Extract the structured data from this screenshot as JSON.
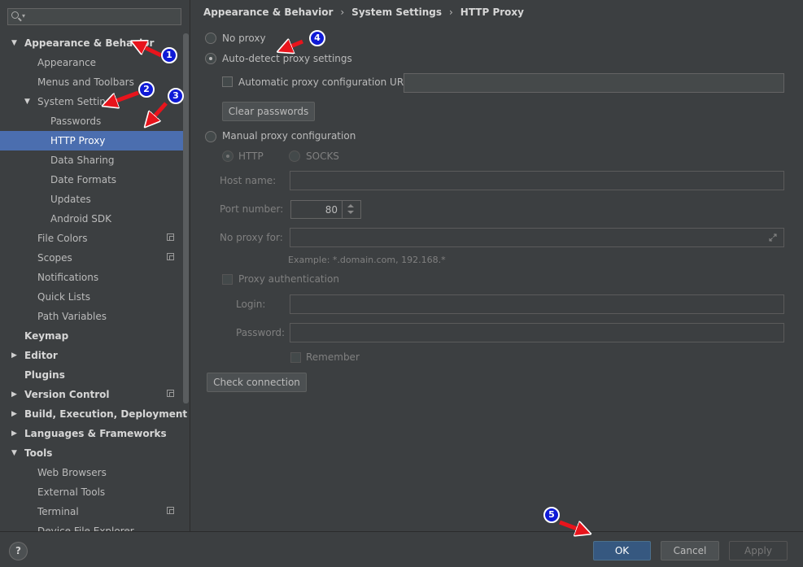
{
  "sidebar": {
    "items": [
      {
        "label": "Appearance & Behavior",
        "bold": true,
        "arrow": "down",
        "indent": 0
      },
      {
        "label": "Appearance",
        "indent": 1
      },
      {
        "label": "Menus and Toolbars",
        "indent": 1
      },
      {
        "label": "System Settings",
        "arrow": "down",
        "indent": 1
      },
      {
        "label": "Passwords",
        "indent": 2
      },
      {
        "label": "HTTP Proxy",
        "indent": 2,
        "selected": true
      },
      {
        "label": "Data Sharing",
        "indent": 2
      },
      {
        "label": "Date Formats",
        "indent": 2
      },
      {
        "label": "Updates",
        "indent": 2
      },
      {
        "label": "Android SDK",
        "indent": 2
      },
      {
        "label": "File Colors",
        "indent": 1,
        "project_icon": true
      },
      {
        "label": "Scopes",
        "indent": 1,
        "project_icon": true
      },
      {
        "label": "Notifications",
        "indent": 1
      },
      {
        "label": "Quick Lists",
        "indent": 1
      },
      {
        "label": "Path Variables",
        "indent": 1
      },
      {
        "label": "Keymap",
        "bold": true,
        "indent": 0
      },
      {
        "label": "Editor",
        "bold": true,
        "arrow": "right",
        "indent": 0
      },
      {
        "label": "Plugins",
        "bold": true,
        "indent": 0
      },
      {
        "label": "Version Control",
        "bold": true,
        "arrow": "right",
        "indent": 0,
        "project_icon": true
      },
      {
        "label": "Build, Execution, Deployment",
        "bold": true,
        "arrow": "right",
        "indent": 0
      },
      {
        "label": "Languages & Frameworks",
        "bold": true,
        "arrow": "right",
        "indent": 0
      },
      {
        "label": "Tools",
        "bold": true,
        "arrow": "down",
        "indent": 0
      },
      {
        "label": "Web Browsers",
        "indent": 1
      },
      {
        "label": "External Tools",
        "indent": 1
      },
      {
        "label": "Terminal",
        "indent": 1,
        "project_icon": true
      },
      {
        "label": "Device File Explorer",
        "indent": 1
      }
    ]
  },
  "breadcrumb": [
    "Appearance & Behavior",
    "System Settings",
    "HTTP Proxy"
  ],
  "proxy": {
    "no_proxy_label": "No proxy",
    "auto_detect_label": "Auto-detect proxy settings",
    "auto_config_url_label": "Automatic proxy configuration URL:",
    "auto_config_url_value": "",
    "clear_passwords_label": "Clear passwords",
    "manual_label": "Manual proxy configuration",
    "http_label": "HTTP",
    "socks_label": "SOCKS",
    "host_name_label": "Host name:",
    "host_name_value": "",
    "port_label": "Port number:",
    "port_value": "80",
    "no_proxy_for_label": "No proxy for:",
    "no_proxy_for_value": "",
    "example_text": "Example: *.domain.com, 192.168.*",
    "proxy_auth_label": "Proxy authentication",
    "login_label": "Login:",
    "password_label": "Password:",
    "remember_label": "Remember",
    "check_connection_label": "Check connection",
    "selected_mode": "auto-detect"
  },
  "footer": {
    "help_label": "?",
    "ok_label": "OK",
    "cancel_label": "Cancel",
    "apply_label": "Apply"
  },
  "annotations": {
    "badges": [
      "1",
      "2",
      "3",
      "4",
      "5"
    ],
    "arrow_color": "#e8141c",
    "badge_color": "#0f1ad6"
  },
  "colors": {
    "background": "#3c3f41",
    "selection": "#4b6eaf",
    "primary_button": "#365880"
  }
}
